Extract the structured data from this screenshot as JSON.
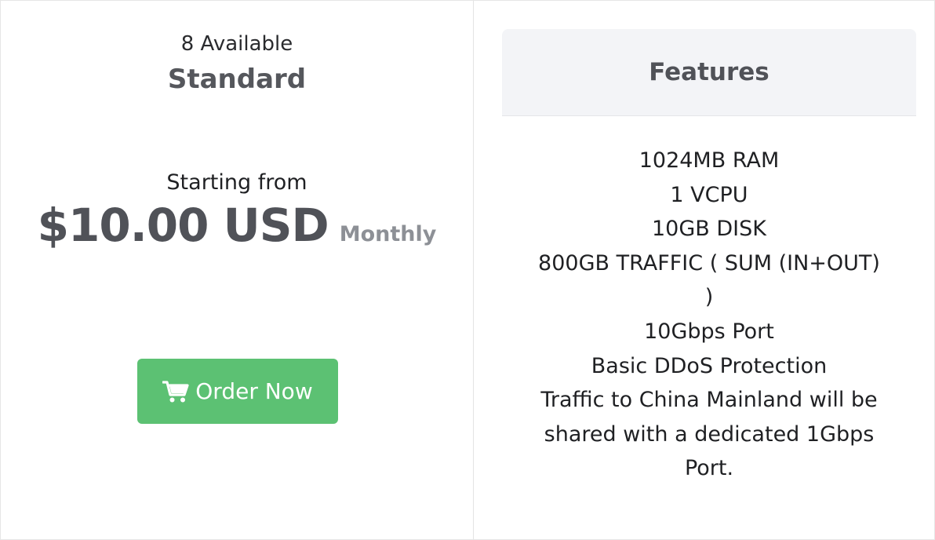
{
  "product": {
    "availability": "8 Available",
    "name": "Standard",
    "starting_label": "Starting from",
    "price": "$10.00 USD",
    "billing_cycle": "Monthly",
    "order_button": "Order Now"
  },
  "features": {
    "title": "Features",
    "items": [
      "1024MB RAM",
      "1 VCPU",
      "10GB DISK",
      "800GB TRAFFIC ( SUM (IN+OUT)",
      ")",
      "10Gbps Port",
      "Basic DDoS Protection",
      "Traffic to China Mainland will be",
      "shared with a dedicated 1Gbps",
      "Port."
    ]
  },
  "colors": {
    "order_button_bg": "#5cc173",
    "price_text": "#505258",
    "cycle_text": "#8d9096",
    "features_header_bg": "#f3f4f7"
  },
  "icons": {
    "order_button_icon": "shopping-cart-icon"
  }
}
